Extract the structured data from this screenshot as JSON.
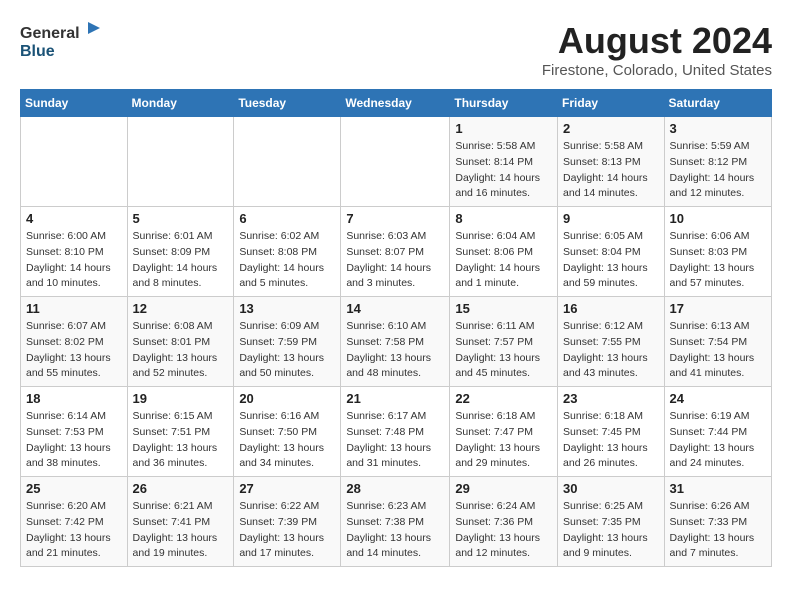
{
  "header": {
    "logo_general": "General",
    "logo_blue": "Blue",
    "title": "August 2024",
    "subtitle": "Firestone, Colorado, United States"
  },
  "weekdays": [
    "Sunday",
    "Monday",
    "Tuesday",
    "Wednesday",
    "Thursday",
    "Friday",
    "Saturday"
  ],
  "weeks": [
    [
      {
        "day": "",
        "detail": ""
      },
      {
        "day": "",
        "detail": ""
      },
      {
        "day": "",
        "detail": ""
      },
      {
        "day": "",
        "detail": ""
      },
      {
        "day": "1",
        "detail": "Sunrise: 5:58 AM\nSunset: 8:14 PM\nDaylight: 14 hours\nand 16 minutes."
      },
      {
        "day": "2",
        "detail": "Sunrise: 5:58 AM\nSunset: 8:13 PM\nDaylight: 14 hours\nand 14 minutes."
      },
      {
        "day": "3",
        "detail": "Sunrise: 5:59 AM\nSunset: 8:12 PM\nDaylight: 14 hours\nand 12 minutes."
      }
    ],
    [
      {
        "day": "4",
        "detail": "Sunrise: 6:00 AM\nSunset: 8:10 PM\nDaylight: 14 hours\nand 10 minutes."
      },
      {
        "day": "5",
        "detail": "Sunrise: 6:01 AM\nSunset: 8:09 PM\nDaylight: 14 hours\nand 8 minutes."
      },
      {
        "day": "6",
        "detail": "Sunrise: 6:02 AM\nSunset: 8:08 PM\nDaylight: 14 hours\nand 5 minutes."
      },
      {
        "day": "7",
        "detail": "Sunrise: 6:03 AM\nSunset: 8:07 PM\nDaylight: 14 hours\nand 3 minutes."
      },
      {
        "day": "8",
        "detail": "Sunrise: 6:04 AM\nSunset: 8:06 PM\nDaylight: 14 hours\nand 1 minute."
      },
      {
        "day": "9",
        "detail": "Sunrise: 6:05 AM\nSunset: 8:04 PM\nDaylight: 13 hours\nand 59 minutes."
      },
      {
        "day": "10",
        "detail": "Sunrise: 6:06 AM\nSunset: 8:03 PM\nDaylight: 13 hours\nand 57 minutes."
      }
    ],
    [
      {
        "day": "11",
        "detail": "Sunrise: 6:07 AM\nSunset: 8:02 PM\nDaylight: 13 hours\nand 55 minutes."
      },
      {
        "day": "12",
        "detail": "Sunrise: 6:08 AM\nSunset: 8:01 PM\nDaylight: 13 hours\nand 52 minutes."
      },
      {
        "day": "13",
        "detail": "Sunrise: 6:09 AM\nSunset: 7:59 PM\nDaylight: 13 hours\nand 50 minutes."
      },
      {
        "day": "14",
        "detail": "Sunrise: 6:10 AM\nSunset: 7:58 PM\nDaylight: 13 hours\nand 48 minutes."
      },
      {
        "day": "15",
        "detail": "Sunrise: 6:11 AM\nSunset: 7:57 PM\nDaylight: 13 hours\nand 45 minutes."
      },
      {
        "day": "16",
        "detail": "Sunrise: 6:12 AM\nSunset: 7:55 PM\nDaylight: 13 hours\nand 43 minutes."
      },
      {
        "day": "17",
        "detail": "Sunrise: 6:13 AM\nSunset: 7:54 PM\nDaylight: 13 hours\nand 41 minutes."
      }
    ],
    [
      {
        "day": "18",
        "detail": "Sunrise: 6:14 AM\nSunset: 7:53 PM\nDaylight: 13 hours\nand 38 minutes."
      },
      {
        "day": "19",
        "detail": "Sunrise: 6:15 AM\nSunset: 7:51 PM\nDaylight: 13 hours\nand 36 minutes."
      },
      {
        "day": "20",
        "detail": "Sunrise: 6:16 AM\nSunset: 7:50 PM\nDaylight: 13 hours\nand 34 minutes."
      },
      {
        "day": "21",
        "detail": "Sunrise: 6:17 AM\nSunset: 7:48 PM\nDaylight: 13 hours\nand 31 minutes."
      },
      {
        "day": "22",
        "detail": "Sunrise: 6:18 AM\nSunset: 7:47 PM\nDaylight: 13 hours\nand 29 minutes."
      },
      {
        "day": "23",
        "detail": "Sunrise: 6:18 AM\nSunset: 7:45 PM\nDaylight: 13 hours\nand 26 minutes."
      },
      {
        "day": "24",
        "detail": "Sunrise: 6:19 AM\nSunset: 7:44 PM\nDaylight: 13 hours\nand 24 minutes."
      }
    ],
    [
      {
        "day": "25",
        "detail": "Sunrise: 6:20 AM\nSunset: 7:42 PM\nDaylight: 13 hours\nand 21 minutes."
      },
      {
        "day": "26",
        "detail": "Sunrise: 6:21 AM\nSunset: 7:41 PM\nDaylight: 13 hours\nand 19 minutes."
      },
      {
        "day": "27",
        "detail": "Sunrise: 6:22 AM\nSunset: 7:39 PM\nDaylight: 13 hours\nand 17 minutes."
      },
      {
        "day": "28",
        "detail": "Sunrise: 6:23 AM\nSunset: 7:38 PM\nDaylight: 13 hours\nand 14 minutes."
      },
      {
        "day": "29",
        "detail": "Sunrise: 6:24 AM\nSunset: 7:36 PM\nDaylight: 13 hours\nand 12 minutes."
      },
      {
        "day": "30",
        "detail": "Sunrise: 6:25 AM\nSunset: 7:35 PM\nDaylight: 13 hours\nand 9 minutes."
      },
      {
        "day": "31",
        "detail": "Sunrise: 6:26 AM\nSunset: 7:33 PM\nDaylight: 13 hours\nand 7 minutes."
      }
    ]
  ]
}
